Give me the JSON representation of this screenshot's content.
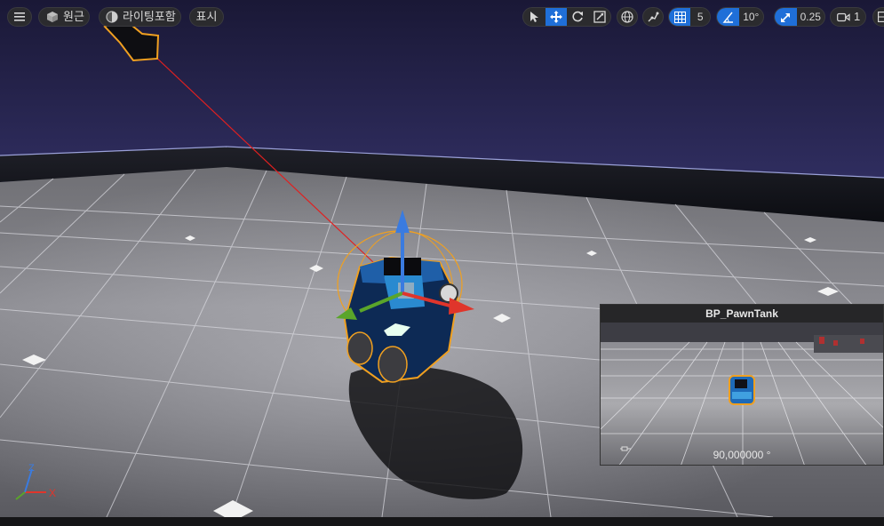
{
  "toolbar": {
    "menu_icon": "hamburger-menu-icon",
    "perspective_label": "원근",
    "lighting_label": "라이팅포함",
    "show_label": "표시",
    "grid_snap_value": "5",
    "rotation_snap_value": "10°",
    "scale_snap_value": "0.25",
    "camera_speed_value": "1"
  },
  "preview": {
    "title": "BP_PawnTank",
    "fov_label": "90,000000 °"
  },
  "axes": {
    "x_label": "X",
    "z_label": "Z"
  },
  "colors": {
    "accent": "#1f6fd8",
    "selection": "#f0a020",
    "axis_x": "#e0352b",
    "axis_y": "#5aa52a",
    "axis_z": "#3a7be0"
  }
}
